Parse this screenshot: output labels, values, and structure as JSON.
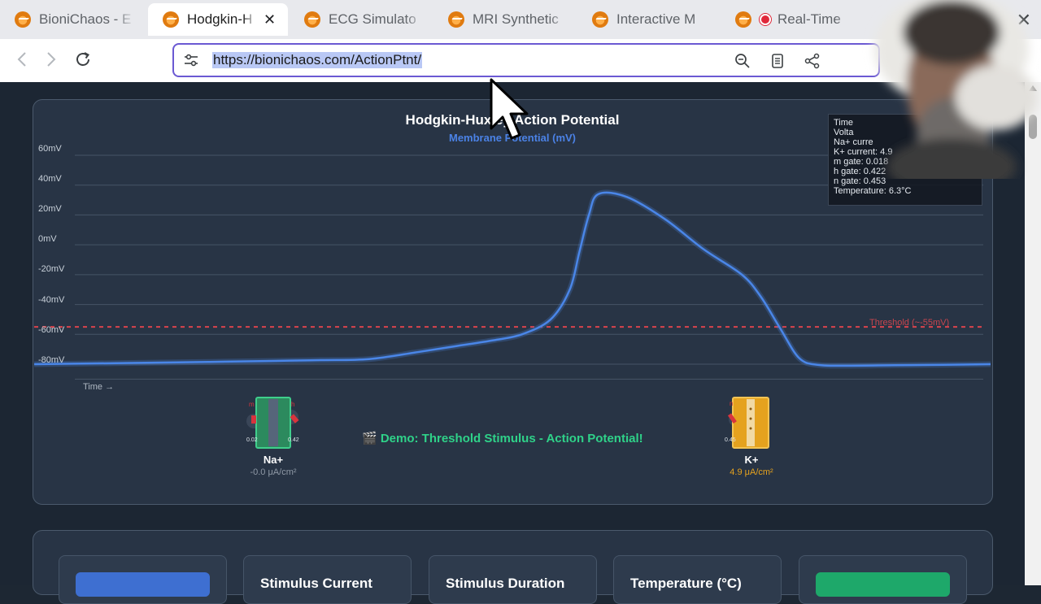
{
  "tabs": [
    {
      "title": "BioniChaos - E",
      "active": false
    },
    {
      "title": "Hodgkin-H",
      "active": true
    },
    {
      "title": "ECG Simulato",
      "active": false
    },
    {
      "title": "MRI Synthetic",
      "active": false
    },
    {
      "title": "Interactive M",
      "active": false
    },
    {
      "title": "Real-Time",
      "active": false,
      "recording": true
    }
  ],
  "toolbar": {
    "url": "https://bionichaos.com/ActionPtnt/",
    "icons": [
      "back-icon",
      "forward-icon",
      "reload-icon",
      "site-info-icon",
      "zoom-icon",
      "reader-mode-icon",
      "share-icon"
    ]
  },
  "chart": {
    "title": "Hodgkin-Huxley Action Potential",
    "subtitle": "Membrane Potential (mV)",
    "time_label": "Time →",
    "threshold_label": "Threshold (~-55mV)"
  },
  "chart_data": {
    "type": "line",
    "title": "Hodgkin-Huxley Action Potential",
    "ylabel": "Membrane Potential (mV)",
    "xlabel": "Time →",
    "y_ticks": [
      "60mV",
      "40mV",
      "20mV",
      "0mV",
      "-20mV",
      "-40mV",
      "-60mV",
      "-80mV"
    ],
    "ylim": [
      -80,
      60
    ],
    "threshold": -55,
    "grid": true,
    "series": [
      {
        "color": "#4a86e8",
        "x": [
          0,
          5,
          10,
          15,
          20,
          25,
          30,
          35,
          40,
          44,
          48,
          51,
          54,
          56,
          57,
          58,
          59,
          62,
          66,
          70,
          74,
          76,
          78,
          80,
          82,
          85,
          90,
          95,
          100
        ],
        "y": [
          -80,
          -79.6,
          -79.2,
          -78.8,
          -78.3,
          -77.8,
          -77.3,
          -76.6,
          -72,
          -68,
          -64,
          -60,
          -50,
          -30,
          -5,
          20,
          34,
          32,
          17,
          -3,
          -20,
          -35,
          -56,
          -76,
          -80.5,
          -81,
          -80.7,
          -80.4,
          -80
        ]
      }
    ]
  },
  "info": {
    "lines": [
      "Time",
      "Volta",
      "Na+ curre",
      "K+ current: 4.9",
      "m gate: 0.018",
      "h gate: 0.422",
      "n gate: 0.453",
      "Temperature: 6.3°C"
    ]
  },
  "channels": {
    "na": {
      "name": "Na+",
      "current": "-0.0 μA/cm²",
      "left_value": "0.02",
      "right_value": "0.42",
      "m": "m",
      "h": "h",
      "color": "#2fa66d"
    },
    "k": {
      "name": "K+",
      "current": "4.9 μA/cm²",
      "left_value": "0.45",
      "n": "n",
      "color": "#e5a21e"
    }
  },
  "demo": {
    "icon": "clapper-board-icon",
    "text": "🎬 Demo: Threshold Stimulus - Action Potential!"
  },
  "controls": {
    "items": [
      "Stimulus Current",
      "Stimulus Duration",
      "Temperature (°C)"
    ],
    "left_button_color": "#3e6fd1",
    "right_button_color": "#1ea86a"
  }
}
